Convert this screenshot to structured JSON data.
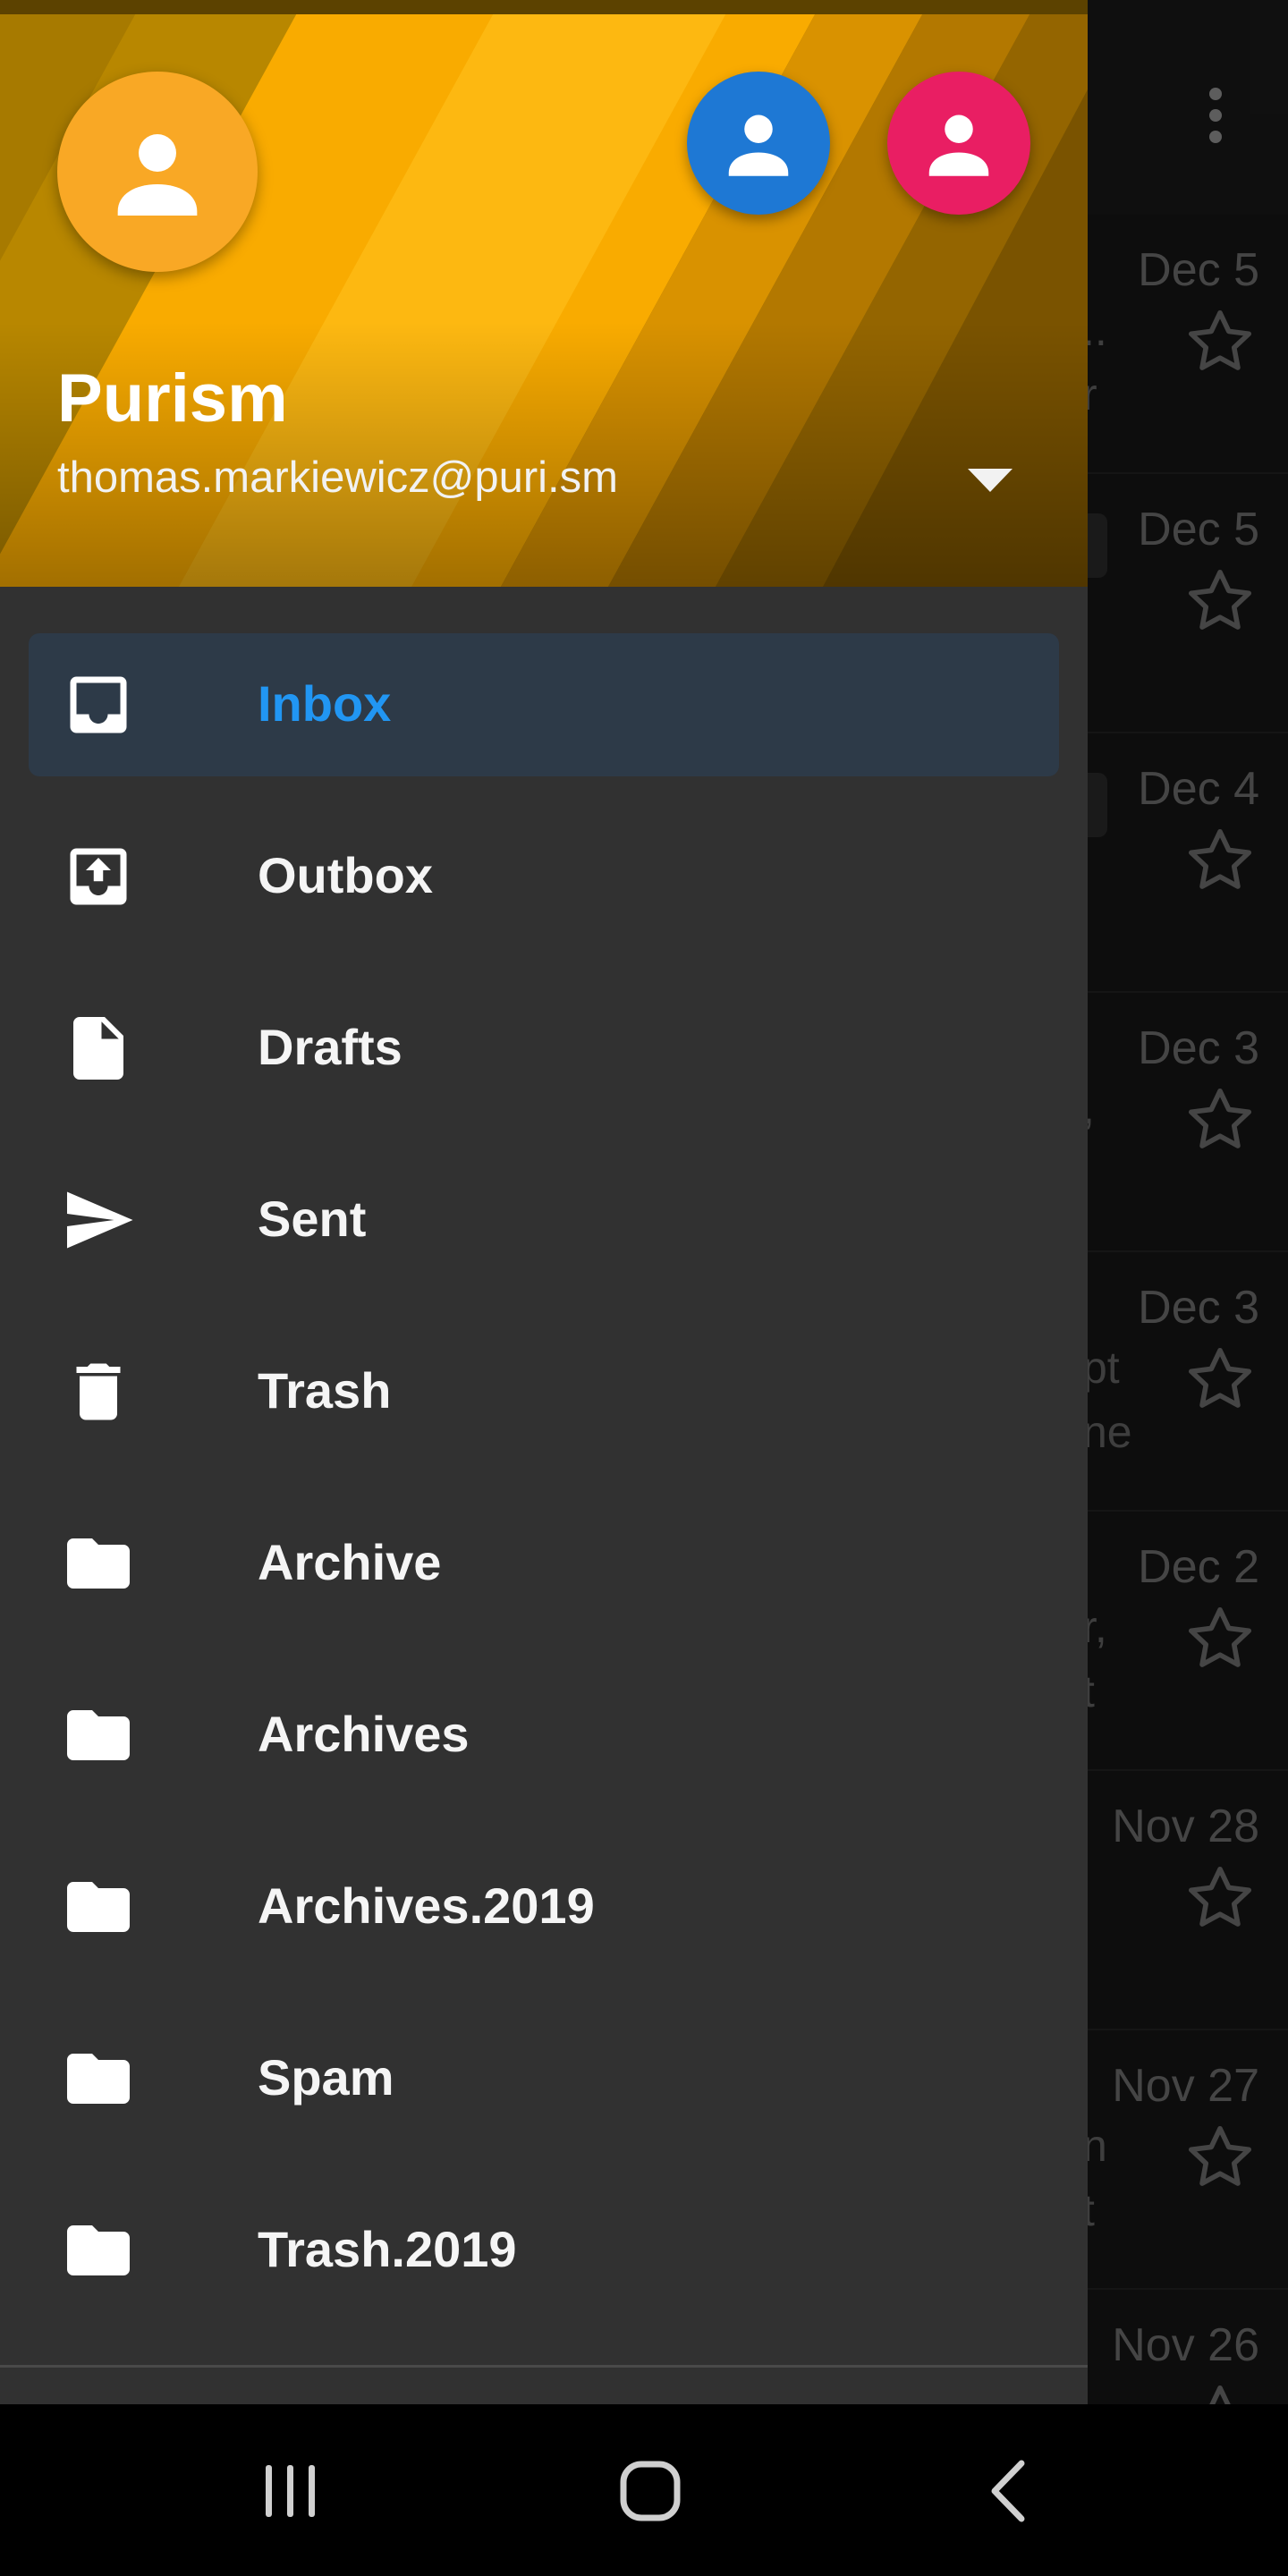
{
  "account": {
    "name": "Purism",
    "email": "thomas.markiewicz@puri.sm"
  },
  "colors": {
    "accent": "#2196f3",
    "header_gold": "#f9ab00",
    "avatar_main": "#f9a825",
    "avatar_secondary_1": "#1e78d4",
    "avatar_secondary_2": "#e91e63",
    "drawer_bg": "#313131",
    "active_item_bg": "#2d3a48"
  },
  "folders": [
    {
      "label": "Inbox",
      "icon": "inbox-icon",
      "active": true
    },
    {
      "label": "Outbox",
      "icon": "outbox-icon",
      "active": false
    },
    {
      "label": "Drafts",
      "icon": "drafts-icon",
      "active": false
    },
    {
      "label": "Sent",
      "icon": "sent-icon",
      "active": false
    },
    {
      "label": "Trash",
      "icon": "trash-icon",
      "active": false
    },
    {
      "label": "Archive",
      "icon": "folder-icon",
      "active": false
    },
    {
      "label": "Archives",
      "icon": "folder-icon",
      "active": false
    },
    {
      "label": "Archives.2019",
      "icon": "folder-icon",
      "active": false
    },
    {
      "label": "Spam",
      "icon": "folder-icon",
      "active": false
    },
    {
      "label": "Trash.2019",
      "icon": "folder-icon",
      "active": false
    }
  ],
  "messages": [
    {
      "date": "Dec 5",
      "preview_a": "..",
      "preview_b": "r"
    },
    {
      "date": "Dec 5",
      "preview_a": "",
      "preview_b": ""
    },
    {
      "date": "Dec 4",
      "preview_a": "",
      "preview_b": ""
    },
    {
      "date": "Dec 3",
      "preview_a": ",",
      "preview_b": ""
    },
    {
      "date": "Dec 3",
      "preview_a": "pt",
      "preview_b": "ne"
    },
    {
      "date": "Dec 2",
      "preview_a": "r,",
      "preview_b": "t"
    },
    {
      "date": "Nov 28",
      "preview_a": "",
      "preview_b": ""
    },
    {
      "date": "Nov 27",
      "preview_a": "n",
      "preview_b": "t"
    },
    {
      "date": "Nov 26",
      "preview_a": "",
      "preview_b": ""
    }
  ],
  "system_nav": {
    "recents": "recents-icon",
    "home": "home-icon",
    "back": "back-icon"
  }
}
